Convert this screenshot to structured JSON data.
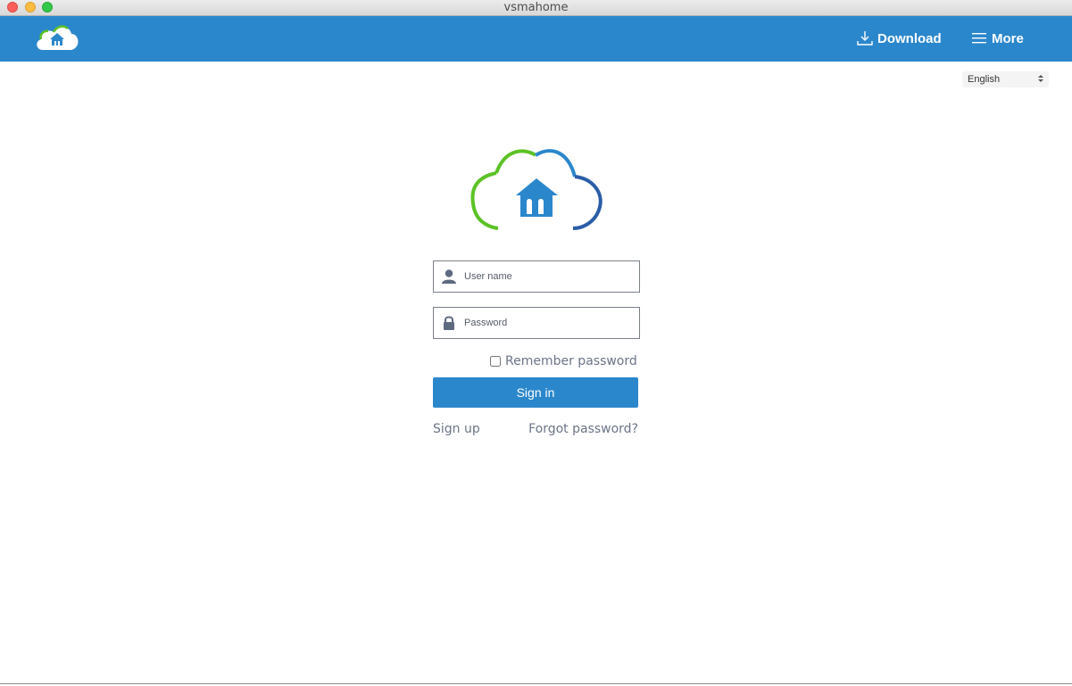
{
  "window": {
    "title": "vsmahome"
  },
  "header": {
    "logo_icon": "cloud-home-logo",
    "download_label": "Download",
    "more_label": "More",
    "colors": {
      "bar": "#2b87cc"
    }
  },
  "language": {
    "selected": "English"
  },
  "login": {
    "username_placeholder": "User name",
    "password_placeholder": "Password",
    "remember_label": "Remember password",
    "signin_label": "Sign in",
    "signup_label": "Sign up",
    "forgot_label": "Forgot password?"
  },
  "colors": {
    "accent": "#2b87cc",
    "logo_green": "#5cc226",
    "logo_blue": "#2b87cc"
  }
}
